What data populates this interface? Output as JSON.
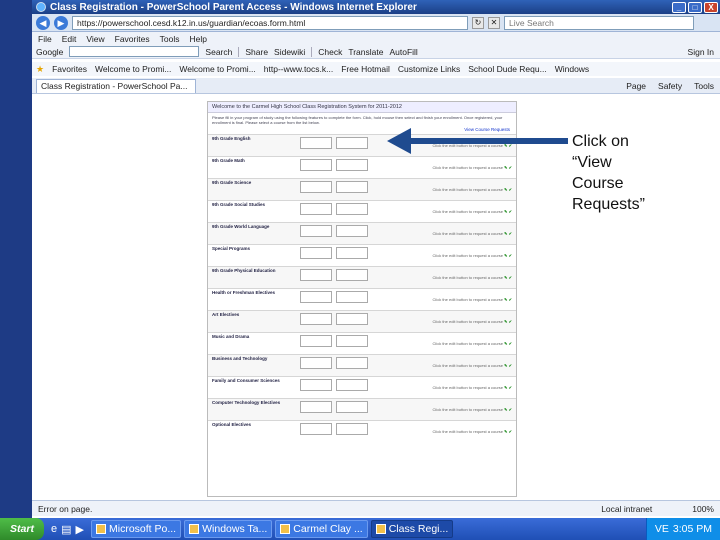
{
  "window": {
    "title": "Class Registration - PowerSchool Parent Access - Windows Internet Explorer",
    "buttons": [
      "_",
      "□",
      "X"
    ]
  },
  "address": {
    "back": "◀",
    "forward": "▶",
    "url": "https://powerschool.cesd.k12.in.us/guardian/ecoas.form.html",
    "refresh": "↻",
    "stop": "✕",
    "search_placeholder": "Live Search"
  },
  "menu": [
    "File",
    "Edit",
    "View",
    "Favorites",
    "Tools",
    "Help"
  ],
  "googlebar": {
    "brand": "Google",
    "items": [
      "Search",
      "Share",
      "Sidewiki",
      "Check",
      "Translate",
      "AutoFill",
      "Sign In"
    ]
  },
  "favorites": {
    "label": "Favorites",
    "items": [
      "Welcome to Promi...",
      "Welcome to Promi...",
      "http--www.tocs.k...",
      "Free Hotmail",
      "Customize Links",
      "School Dude Requ...",
      "Windows"
    ]
  },
  "tabs": {
    "active": "Class Registration - PowerSchool Pa...",
    "commands": [
      "Page",
      "Safety",
      "Tools"
    ]
  },
  "page": {
    "header": "Welcome to the Carmel High School Class Registration System for 2011-2012",
    "intro": "Please fill in your program of study using the following features to complete the form. Click, hold mouse then select and finish your enrollment. Once registered, your enrollment is final. Please select a course from the list below.",
    "link": "View Course Requests",
    "courses": [
      {
        "name": "9th Grade English",
        "note": "Click the edit button to request a course"
      },
      {
        "name": "9th Grade Math",
        "note": "Click the edit button to request a course"
      },
      {
        "name": "9th Grade Science",
        "note": "Click the edit button to request a course"
      },
      {
        "name": "9th Grade Social Studies",
        "note": "Click the edit button to request a course"
      },
      {
        "name": "9th Grade World Language",
        "note": "Click the edit button to request a course"
      },
      {
        "name": "Special Programs",
        "note": "Click the edit button to request a course"
      },
      {
        "name": "9th Grade Physical Education",
        "note": "Click the edit button to request a course"
      },
      {
        "name": "Health or Freshman Electives",
        "note": "Click the edit button to request a course"
      },
      {
        "name": "Art Electives",
        "note": "Click the edit button to request a course"
      },
      {
        "name": "Music and Drama",
        "note": "Click the edit button to request a course"
      },
      {
        "name": "Business and Technology",
        "note": "Click the edit button to request a course"
      },
      {
        "name": "Family and Consumer Sciences",
        "note": "Click the edit button to request a course"
      },
      {
        "name": "Computer Technology Electives",
        "note": "Click the edit button to request a course"
      },
      {
        "name": "Optional Electives",
        "note": "Click the edit button to request a course"
      }
    ]
  },
  "callout": {
    "line1": "Click on",
    "line2": "“View",
    "line3": "Course",
    "line4": "Requests”"
  },
  "status": {
    "left": "Error on page.",
    "zone": "Local intranet",
    "zoom": "100%"
  },
  "taskbar": {
    "start": "Start",
    "tasks": [
      "Microsoft Po...",
      "Windows Ta...",
      "Carmel Clay ...",
      "Class Regi..."
    ],
    "tray_icons": "VE",
    "time": "3:05 PM"
  },
  "colors": {
    "accent": "#1e3b85",
    "callout_arrow": "#1f4b8f"
  }
}
